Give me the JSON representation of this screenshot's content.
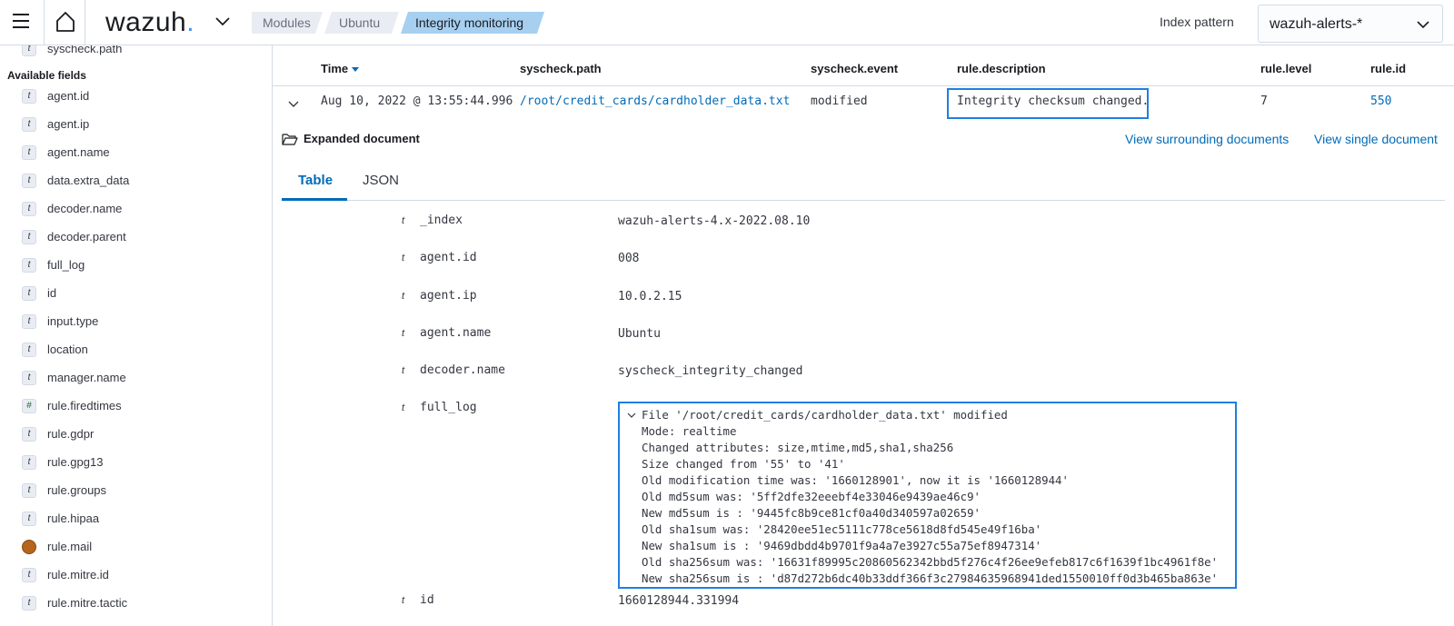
{
  "header": {
    "logo_text": "wazuh",
    "logo_dot": ".",
    "breadcrumbs": [
      "Modules",
      "Ubuntu",
      "Integrity monitoring"
    ],
    "info_glyph": "i",
    "index_pattern_label": "Index pattern",
    "index_pattern_value": "wazuh-alerts-*"
  },
  "sidebar": {
    "top_partial_field": "syscheck.path",
    "available_label": "Available fields",
    "fields": [
      {
        "type": "t",
        "name": "agent.id"
      },
      {
        "type": "t",
        "name": "agent.ip"
      },
      {
        "type": "t",
        "name": "agent.name"
      },
      {
        "type": "t",
        "name": "data.extra_data"
      },
      {
        "type": "t",
        "name": "decoder.name"
      },
      {
        "type": "t",
        "name": "decoder.parent"
      },
      {
        "type": "t",
        "name": "full_log"
      },
      {
        "type": "t",
        "name": "id"
      },
      {
        "type": "t",
        "name": "input.type"
      },
      {
        "type": "t",
        "name": "location"
      },
      {
        "type": "t",
        "name": "manager.name"
      },
      {
        "type": "#",
        "name": "rule.firedtimes"
      },
      {
        "type": "t",
        "name": "rule.gdpr"
      },
      {
        "type": "t",
        "name": "rule.gpg13"
      },
      {
        "type": "t",
        "name": "rule.groups"
      },
      {
        "type": "t",
        "name": "rule.hipaa"
      },
      {
        "type": "geo",
        "name": "rule.mail"
      },
      {
        "type": "t",
        "name": "rule.mitre.id"
      },
      {
        "type": "t",
        "name": "rule.mitre.tactic"
      }
    ]
  },
  "table": {
    "columns": [
      "Time",
      "syscheck.path",
      "syscheck.event",
      "rule.description",
      "rule.level",
      "rule.id"
    ],
    "row": {
      "time": "Aug 10, 2022 @ 13:55:44.996",
      "path": "/root/credit_cards/cardholder_data.txt",
      "event": "modified",
      "description": "Integrity checksum changed.",
      "level": "7",
      "id": "550"
    }
  },
  "expanded": {
    "title": "Expanded document",
    "view_surrounding": "View surrounding documents",
    "view_single": "View single document",
    "tabs": [
      "Table",
      "JSON"
    ],
    "type_glyph": "t",
    "fields": [
      {
        "key": "_index",
        "value": "wazuh-alerts-4.x-2022.08.10",
        "link": false
      },
      {
        "key": "agent.id",
        "value": "008",
        "link": true
      },
      {
        "key": "agent.ip",
        "value": "10.0.2.15",
        "link": false
      },
      {
        "key": "agent.name",
        "value": "Ubuntu",
        "link": true
      },
      {
        "key": "decoder.name",
        "value": "syscheck_integrity_changed",
        "link": false
      },
      {
        "key": "full_log",
        "value": "",
        "link": false
      },
      {
        "key": "id",
        "value": "1660128944.331994",
        "link": false
      }
    ],
    "full_log_lines": [
      "File '/root/credit_cards/cardholder_data.txt' modified",
      "Mode: realtime",
      "Changed attributes: size,mtime,md5,sha1,sha256",
      "Size changed from '55' to '41'",
      "Old modification time was: '1660128901', now it is '1660128944'",
      "Old md5sum was: '5ff2dfe32eeebf4e33046e9439ae46c9'",
      "New md5sum is : '9445fc8b9ce81cf0a40d340597a02659'",
      "Old sha1sum was: '28420ee51ec5111c778ce5618d8fd545e49f16ba'",
      "New sha1sum is : '9469dbdd4b9701f9a4a7e3927c55a75ef8947314'",
      "Old sha256sum was: '16631f89995c20860562342bbd5f276c4f26ee9efeb817c6f1639f1bc4961f8e'",
      "New sha256sum is : 'd87d272b6dc40b33ddf366f3c27984635968941ded1550010ff0d3b465ba863e'"
    ]
  },
  "colors": {
    "accent": "#006bb8",
    "highlight_box": "#1f7fe0",
    "active_breadcrumb": "#a6cff0"
  }
}
